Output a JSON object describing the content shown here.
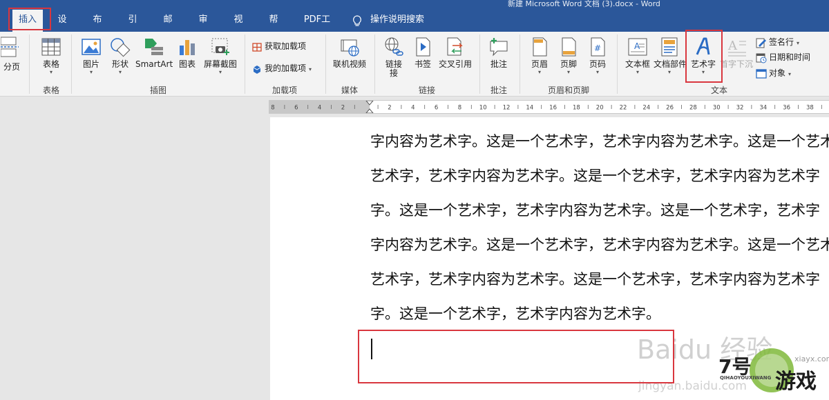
{
  "window": {
    "title": "新建 Microsoft Word 文档 (3).docx  -  Word"
  },
  "tabs": [
    {
      "label": "插入",
      "active": true
    },
    {
      "label": "设计"
    },
    {
      "label": "布局"
    },
    {
      "label": "引用"
    },
    {
      "label": "邮件"
    },
    {
      "label": "审阅"
    },
    {
      "label": "视图"
    },
    {
      "label": "帮助"
    },
    {
      "label": "PDF工具"
    }
  ],
  "tell_me": {
    "label": "操作说明搜索"
  },
  "ribbon": {
    "pages": {
      "page_break": "分页"
    },
    "tables": {
      "table": "表格",
      "group": "表格"
    },
    "illustrations": {
      "pictures": "图片",
      "shapes": "形状",
      "smartart": "SmartArt",
      "chart": "图表",
      "screenshot": "屏幕截图",
      "group": "插图"
    },
    "addins": {
      "get_addins": "获取加载项",
      "my_addins": "我的加载项",
      "group": "加载项"
    },
    "media": {
      "online_video": "联机视频",
      "group": "媒体"
    },
    "links": {
      "link": "链接",
      "link2": "接",
      "bookmark": "书签",
      "cross_ref": "交叉引用",
      "group": "链接"
    },
    "comments": {
      "comment": "批注",
      "group": "批注"
    },
    "header_footer": {
      "header": "页眉",
      "footer": "页脚",
      "page_number": "页码",
      "group": "页眉和页脚"
    },
    "text": {
      "textbox": "文本框",
      "quick_parts": "文档部件",
      "wordart": "艺术字",
      "drop_cap": "首字下沉",
      "signature_line": "签名行",
      "date_time": "日期和时间",
      "object": "对象",
      "group": "文本"
    }
  },
  "ruler": {
    "labels": [
      "8",
      "6",
      "4",
      "2",
      "",
      "2",
      "4",
      "6",
      "8",
      "10",
      "12",
      "14",
      "16",
      "18",
      "20",
      "22",
      "24",
      "26",
      "28",
      "30",
      "32",
      "34",
      "36",
      "38"
    ]
  },
  "document": {
    "lines": [
      "字内容为艺术字。这是一个艺术字，艺术字内容为艺术字。这是一个艺术",
      "艺术字，艺术字内容为艺术字。这是一个艺术字，艺术字内容为艺术字",
      "字。这是一个艺术字，艺术字内容为艺术字。这是一个艺术字，艺术字",
      "字内容为艺术字。这是一个艺术字，艺术字内容为艺术字。这是一个艺术",
      "艺术字，艺术字内容为艺术字。这是一个艺术字，艺术字内容为艺术字",
      "字。这是一个艺术字，艺术字内容为艺术字。"
    ]
  },
  "watermarks": {
    "baidu": "Baidu 经验",
    "jingyan": "jingyan.baidu.com",
    "site_num": "7号",
    "site_game": "游戏",
    "site_pinyin": "QIHAOYOUXIWANG",
    "site_domain": "xiayx.com"
  },
  "colors": {
    "accent": "#2b579a",
    "highlight": "#d9363e",
    "wordart_icon": "#2b6cc4"
  }
}
